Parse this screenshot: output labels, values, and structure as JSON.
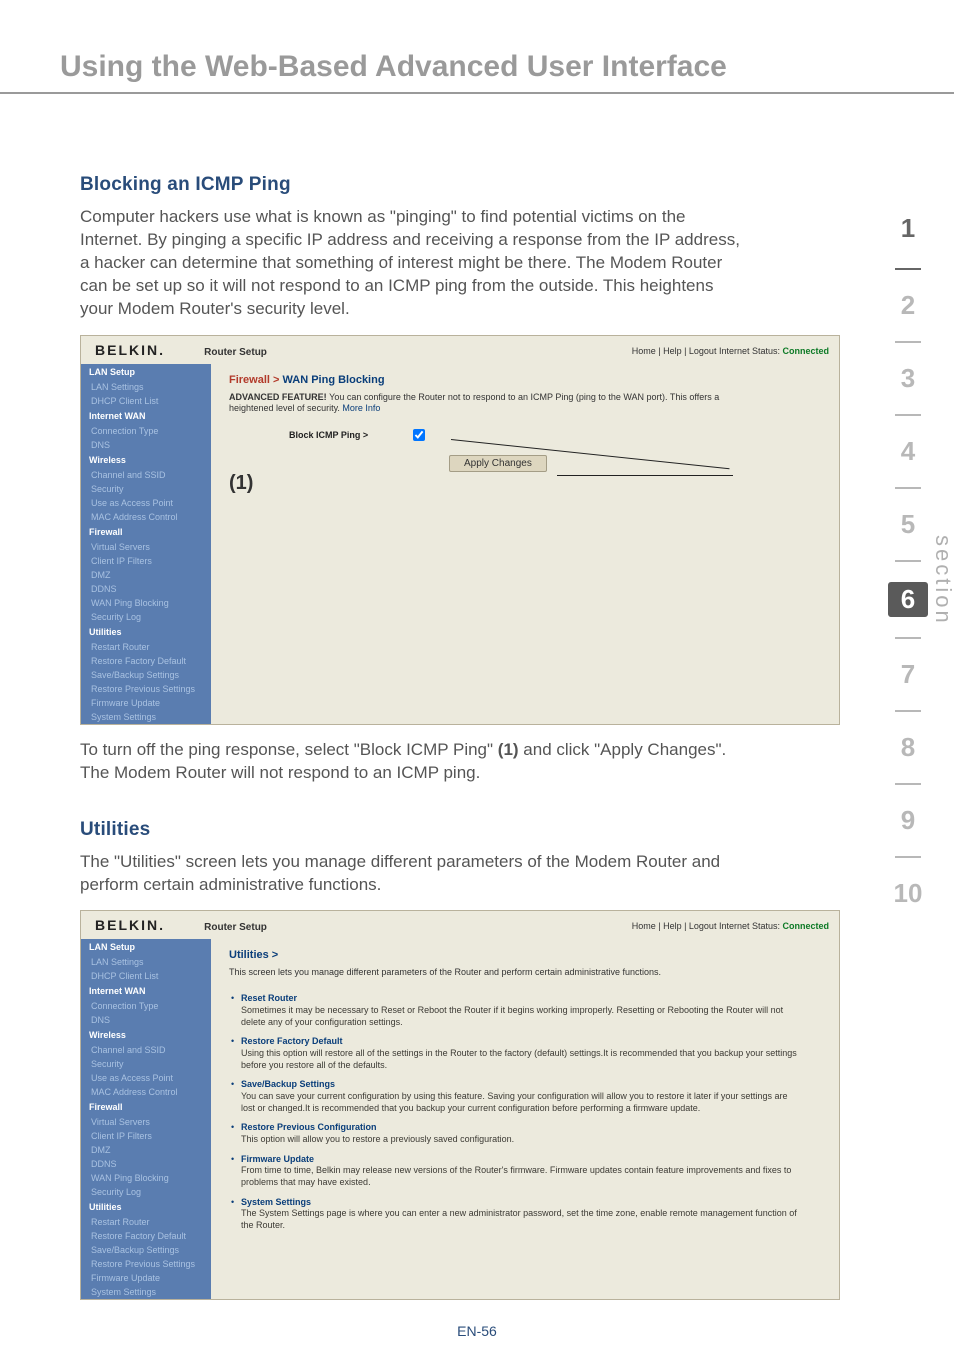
{
  "page": {
    "title": "Using the Web-Based Advanced User Interface",
    "footer": "EN-56"
  },
  "section1": {
    "heading": "Blocking an ICMP Ping",
    "para": "Computer hackers use what is known as \"pinging\" to find potential victims on the Internet. By pinging a specific IP address and receiving a response from the IP address, a hacker can determine that something of interest might be there. The Modem Router can be set up so it will not respond to an ICMP ping from the outside. This heightens your Modem Router's security level.",
    "after_p1": "To turn off the ping response, select \"Block ICMP Ping\" ",
    "after_b1": "(1)",
    "after_p2": " and click \"Apply Changes\". The Modem Router will not respond to an ICMP ping."
  },
  "section2": {
    "heading": "Utilities",
    "para": "The \"Utilities\" screen lets you manage different parameters of the Modem Router and perform certain administrative functions."
  },
  "shot_common": {
    "logo": "BELKIN",
    "router_setup": "Router Setup",
    "topbar_links": "Home | Help | Logout    Internet Status: ",
    "topbar_status": "Connected"
  },
  "shot1": {
    "title_a": "Firewall > ",
    "title_b": "WAN Ping Blocking",
    "desc_a": "ADVANCED FEATURE! ",
    "desc_b": "You can configure the Router not to respond to an ICMP Ping (ping to the WAN port). This offers a heightened level of security. ",
    "desc_link": "More Info",
    "row_label": "Block ICMP Ping >",
    "apply": "Apply Changes",
    "callout": "(1)"
  },
  "shot2": {
    "title_a": "Utilities >",
    "intro": "This screen lets you manage different parameters of the Router and perform certain administrative functions.",
    "items": [
      {
        "t": "Reset Router",
        "d": "Sometimes it may be necessary to Reset or Reboot the Router if it begins working improperly. Resetting or Rebooting the Router will not delete any of your configuration settings."
      },
      {
        "t": "Restore Factory Default",
        "d": "Using this option will restore all of the settings in the Router to the factory (default) settings.It is recommended that you backup your settings before you restore all of the defaults."
      },
      {
        "t": "Save/Backup Settings",
        "d": "You can save your current configuration by using this feature. Saving your configuration will allow you to restore it later if your settings are lost or changed.It is recommended that you backup your current configuration before performing a firmware update."
      },
      {
        "t": "Restore Previous Configuration",
        "d": "This option will allow you to restore a previously saved configuration."
      },
      {
        "t": "Firmware Update",
        "d": "From time to time, Belkin may release new versions of the Router's firmware. Firmware updates contain feature improvements and fixes to problems that may have existed."
      },
      {
        "t": "System Settings",
        "d": "The System Settings page is where you can enter a new administrator password, set the time zone, enable remote management function of the Router."
      }
    ]
  },
  "nav": {
    "groups": [
      {
        "h": "LAN Setup",
        "items": [
          "LAN Settings",
          "DHCP Client List"
        ]
      },
      {
        "h": "Internet WAN",
        "items": [
          "Connection Type",
          "DNS"
        ]
      },
      {
        "h": "Wireless",
        "items": [
          "Channel and SSID",
          "Security",
          "Use as Access Point",
          "MAC Address Control"
        ]
      },
      {
        "h": "Firewall",
        "items": [
          "Virtual Servers",
          "Client IP Filters",
          "DMZ",
          "DDNS",
          "WAN Ping Blocking",
          "Security Log"
        ]
      },
      {
        "h": "Utilities",
        "items": [
          "Restart Router",
          "Restore Factory Default",
          "Save/Backup Settings",
          "Restore Previous Settings",
          "Firmware Update",
          "System Settings"
        ]
      }
    ]
  },
  "tabs": [
    "1",
    "2",
    "3",
    "4",
    "5",
    "6",
    "7",
    "8",
    "9",
    "10"
  ],
  "tabs_label": "section"
}
